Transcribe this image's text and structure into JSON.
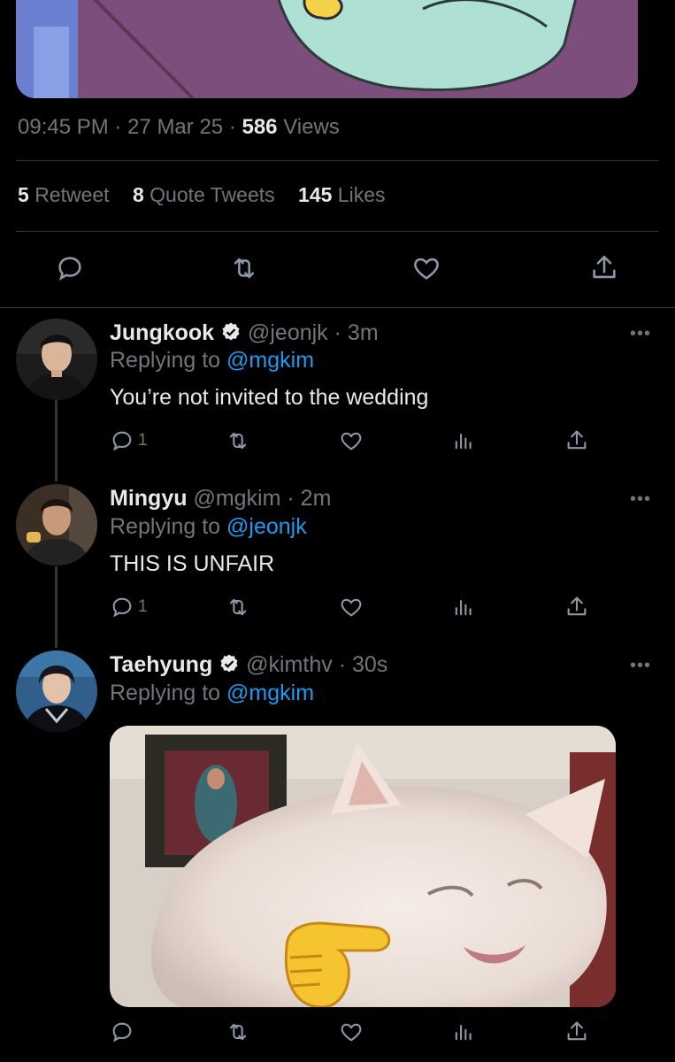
{
  "tweet": {
    "time": "09:45 PM",
    "date": "27 Mar 25",
    "views_count": "586",
    "views_label": "Views",
    "separator": "·",
    "stats": {
      "retweets_count": "5",
      "retweets_label": "Retweet",
      "quotes_count": "8",
      "quotes_label": "Quote Tweets",
      "likes_count": "145",
      "likes_label": "Likes"
    }
  },
  "replies": [
    {
      "name": "Jungkook",
      "verified": true,
      "handle": "@jeonjk",
      "time": "· 3m",
      "replying_prefix": "Replying to",
      "replying_to": "@mgkim",
      "text": "You’re not invited to the wedding",
      "reply_count": "1",
      "more": "•••"
    },
    {
      "name": "Mingyu",
      "verified": false,
      "handle": "@mgkim",
      "time": "· 2m",
      "replying_prefix": "Replying to",
      "replying_to": "@jeonjk",
      "text": "THIS IS UNFAIR",
      "reply_count": "1",
      "more": "•••"
    },
    {
      "name": "Taehyung",
      "verified": true,
      "handle": "@kimthv",
      "time": "· 30s",
      "replying_prefix": "Replying to",
      "replying_to": "@mgkim",
      "text": "",
      "reply_count": "",
      "more": "•••"
    }
  ],
  "icons": {
    "reply": "reply-icon",
    "retweet": "retweet-icon",
    "like": "heart-icon",
    "analytics": "analytics-icon",
    "share": "share-icon",
    "verified": "verified-badge-icon"
  },
  "colors": {
    "background": "#000000",
    "text": "#e7e9ea",
    "muted": "#71767b",
    "mention": "#1d9bf0",
    "divider": "#2f3336"
  }
}
